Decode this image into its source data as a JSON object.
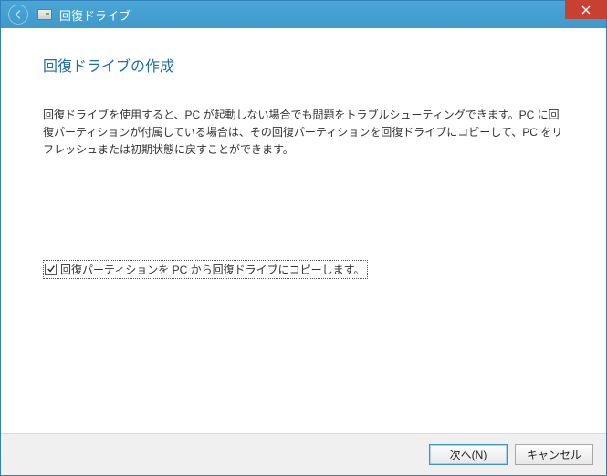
{
  "titlebar": {
    "title": "回復ドライブ"
  },
  "content": {
    "heading": "回復ドライブの作成",
    "body": "回復ドライブを使用すると、PC が起動しない場合でも問題をトラブルシューティングできます。PC に回復パーティションが付属している場合は、その回復パーティションを回復ドライブにコピーして、PC をリフレッシュまたは初期状態に戻すことができます。",
    "checkbox_label": "回復パーティションを PC から回復ドライブにコピーします。",
    "checkbox_checked": true
  },
  "footer": {
    "next_label_prefix": "次へ(",
    "next_label_key": "N",
    "next_label_suffix": ")",
    "cancel_label": "キャンセル"
  }
}
